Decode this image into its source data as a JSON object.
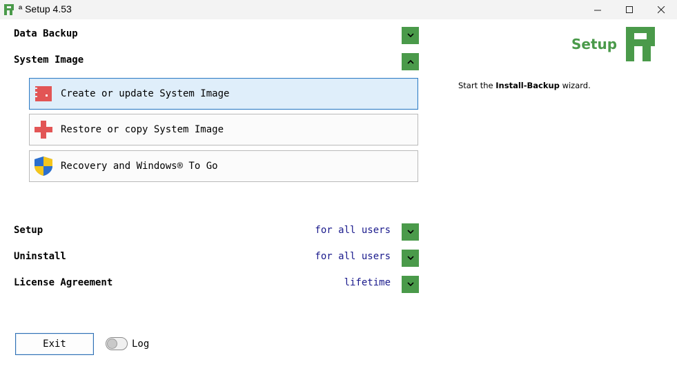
{
  "window": {
    "title": "ª Setup 4.53",
    "icons": {
      "app": "app-logo-icon",
      "minimize": "minimize-icon",
      "maximize": "maximize-icon",
      "close": "close-icon"
    }
  },
  "sections": {
    "data_backup": {
      "label": "Data Backup",
      "expanded": false
    },
    "system_image": {
      "label": "System Image",
      "expanded": true
    }
  },
  "system_image_options": [
    {
      "label": "Create or update System Image",
      "icon": "drive-image-icon",
      "selected": true
    },
    {
      "label": "Restore or copy System Image",
      "icon": "red-cross-icon",
      "selected": false
    },
    {
      "label": "Recovery and Windows® To Go",
      "icon": "windows-shield-icon",
      "selected": false
    }
  ],
  "settings": {
    "setup": {
      "label": "Setup",
      "value": "for all users"
    },
    "uninstall": {
      "label": "Uninstall",
      "value": "for all users"
    },
    "license": {
      "label": "License Agreement",
      "value": "lifetime"
    }
  },
  "side_panel": {
    "heading": "Setup",
    "desc_prefix": "Start the ",
    "desc_bold": "Install-Backup",
    "desc_suffix": " wizard."
  },
  "footer": {
    "exit_label": "Exit",
    "log_label": "Log",
    "log_enabled": false
  },
  "colors": {
    "accent_green": "#4a9a4a",
    "value_blue": "#1a1a8c",
    "selected_bg": "#dfeefa",
    "selected_border": "#2f7cc4"
  }
}
